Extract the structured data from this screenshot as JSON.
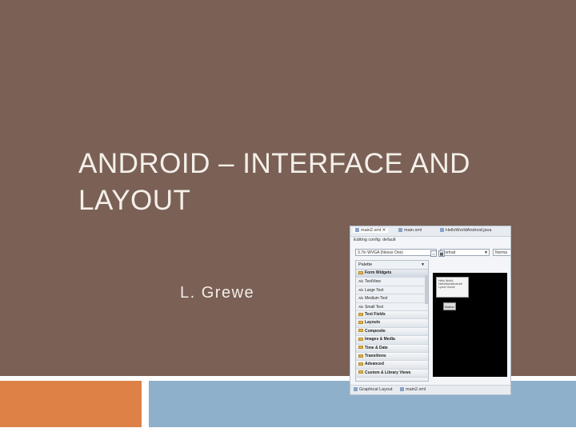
{
  "slide": {
    "title_line1": "ANDROID – INTERFACE AND",
    "title_line2": "LAYOUT",
    "author": "L. Grewe",
    "colors": {
      "background": "#7a6055",
      "footer_left": "#dd8146",
      "footer_right": "#8fb0cb"
    }
  },
  "screenshot": {
    "tabs": [
      "main2.xml",
      "main.xml",
      "HelloWorldAndroid.java"
    ],
    "config_label": "Editing config: default",
    "device": "3.7in WVGA (Nexus One)",
    "orientation": "Portrait",
    "theme": "Norma",
    "palette_title": "Palette",
    "palette_rows": [
      {
        "label": "Form Widgets",
        "kind": "category"
      },
      {
        "label": "TextView",
        "kind": "widget"
      },
      {
        "label": "Large Text",
        "kind": "widget"
      },
      {
        "label": "Medium Text",
        "kind": "widget"
      },
      {
        "label": "Small Text",
        "kind": "widget"
      },
      {
        "label": "Text Fields",
        "kind": "category"
      },
      {
        "label": "Layouts",
        "kind": "category"
      },
      {
        "label": "Composite",
        "kind": "category"
      },
      {
        "label": "Images & Media",
        "kind": "category"
      },
      {
        "label": "Time & Date",
        "kind": "category"
      },
      {
        "label": "Transitions",
        "kind": "category"
      },
      {
        "label": "Advanced",
        "kind": "category"
      },
      {
        "label": "Custom & Library Views",
        "kind": "category"
      }
    ],
    "dialog_text": "Hello World, HelloWorldAndroid! Lynne Grewe",
    "button_label": "Button",
    "bottom_tabs": [
      "Graphical Layout",
      "main2.xml"
    ]
  }
}
